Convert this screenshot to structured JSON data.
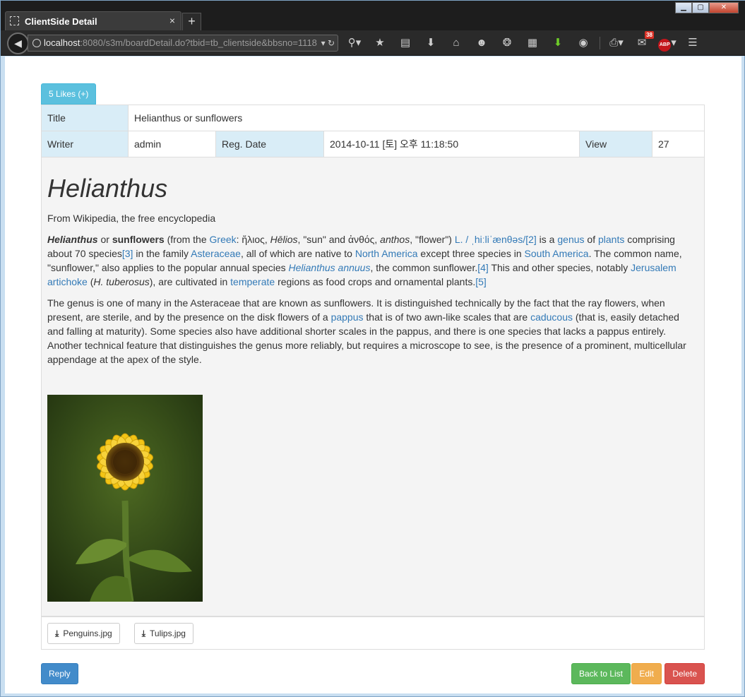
{
  "browser": {
    "tab_title": "ClientSide Detail",
    "tab_close": "×",
    "new_tab": "+",
    "url_host": "localhost",
    "url_path": ":8080/s3m/boardDetail.do?tbid=tb_clientside&bbsno=1118",
    "window_min": "▁",
    "window_max": "▢",
    "window_close": "✕"
  },
  "likes": {
    "label": "5 Likes (+)"
  },
  "meta": {
    "title_label": "Title",
    "title_value": "Helianthus or sunflowers",
    "writer_label": "Writer",
    "writer_value": "admin",
    "regdate_label": "Reg. Date",
    "regdate_value": "2014-10-11 [토] 오후 11:18:50",
    "view_label": "View",
    "view_value": "27"
  },
  "article": {
    "heading": "Helianthus",
    "subtitle": "From Wikipedia, the free encyclopedia",
    "p1": {
      "t1": "Helianthus",
      "t2": " or ",
      "t3": "sunflowers",
      "t4": " (from the ",
      "l_greek": "Greek",
      "t5": ": ἥλιος, ",
      "t6": "Hēlios",
      "t7": ", \"sun\" and ἀνθός, ",
      "t8": "anthos",
      "t9": ", \"flower\") ",
      "l_pron": "L. / ˌhiːliˈænθəs/",
      "l_ref2": "[2]",
      "t10": " is a ",
      "l_genus": "genus",
      "t11": " of ",
      "l_plants": "plants",
      "t12": " comprising about 70 species",
      "l_ref3": "[3]",
      "t13": " in the family ",
      "l_aster": "Asteraceae",
      "t14": ", all of which are native to ",
      "l_na": "North America",
      "t15": " except three species in ",
      "l_sa": "South America",
      "t16": ". The common name, \"sunflower,\" also applies to the popular annual species ",
      "l_annuus": "Helianthus annuus",
      "t17": ", the common sunflower.",
      "l_ref4": "[4]",
      "t18": " This and other species, notably ",
      "l_jerusalem": "Jerusalem artichoke",
      "t19": " (",
      "t20": "H. tuberosus",
      "t21": "), are cultivated in ",
      "l_temperate": "temperate",
      "t22": " regions as food crops and ornamental plants.",
      "l_ref5": "[5]"
    },
    "p2": {
      "t1": "The genus is one of many in the Asteraceae that are known as sunflowers. It is distinguished technically by the fact that the ray flowers, when present, are sterile, and by the presence on the disk flowers of a ",
      "l_pappus": "pappus",
      "t2": " that is of two awn-like scales that are ",
      "l_caducous": "caducous",
      "t3": " (that is, easily detached and falling at maturity). Some species also have additional shorter scales in the pappus, and there is one species that lacks a pappus entirely. Another technical feature that distinguishes the genus more reliably, but requires a microscope to see, is the presence of a prominent, multicellular appendage at the apex of the style."
    }
  },
  "attachments": [
    {
      "name": "Penguins.jpg"
    },
    {
      "name": "Tulips.jpg"
    }
  ],
  "actions": {
    "reply": "Reply",
    "back": "Back to List",
    "edit": "Edit",
    "delete": "Delete"
  },
  "colors": {
    "info": "#5bc0de",
    "primary": "#428bca",
    "success": "#5cb85c",
    "warning": "#f0ad4e",
    "danger": "#d9534f",
    "label_bg": "#d9edf7",
    "link": "#337ab7"
  },
  "icons": {
    "toolbar": [
      "search-icon",
      "bookmark-star-icon",
      "reading-list-icon",
      "download-icon",
      "home-icon",
      "chat-icon",
      "addon-icon",
      "screenshot-icon",
      "download-helper-icon",
      "eye-icon",
      "print-icon",
      "gmail-icon",
      "adblock-icon",
      "menu-icon"
    ],
    "gmail_badge": "38",
    "abp_label": "ABP"
  }
}
